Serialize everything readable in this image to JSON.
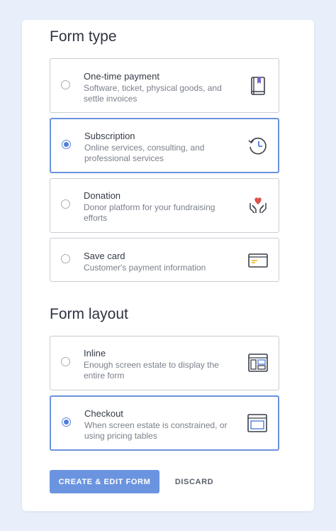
{
  "form_type": {
    "title": "Form type",
    "options": [
      {
        "title": "One-time payment",
        "description": "Software, ticket, physical goods, and settle invoices",
        "icon": "book-icon",
        "selected": false
      },
      {
        "title": "Subscription",
        "description": "Online services, consulting, and professional services",
        "icon": "history-clock-icon",
        "selected": true
      },
      {
        "title": "Donation",
        "description": "Donor platform for your fundraising efforts",
        "icon": "heart-hands-icon",
        "selected": false
      },
      {
        "title": "Save card",
        "description": "Customer's payment information",
        "icon": "credit-card-icon",
        "selected": false
      }
    ]
  },
  "form_layout": {
    "title": "Form layout",
    "options": [
      {
        "title": "Inline",
        "description": "Enough screen estate to display the entire form",
        "icon": "inline-layout-icon",
        "selected": false
      },
      {
        "title": "Checkout",
        "description": "When screen estate is constrained, or using pricing tables",
        "icon": "checkout-window-icon",
        "selected": true
      }
    ]
  },
  "actions": {
    "primary_label": "CREATE & EDIT FORM",
    "secondary_label": "DISCARD"
  },
  "colors": {
    "accent": "#6b94e0",
    "selected_border": "#6b92de",
    "icon_accent_purple": "#7b68c8",
    "icon_accent_red": "#d9534f",
    "icon_accent_yellow": "#f0b429"
  }
}
